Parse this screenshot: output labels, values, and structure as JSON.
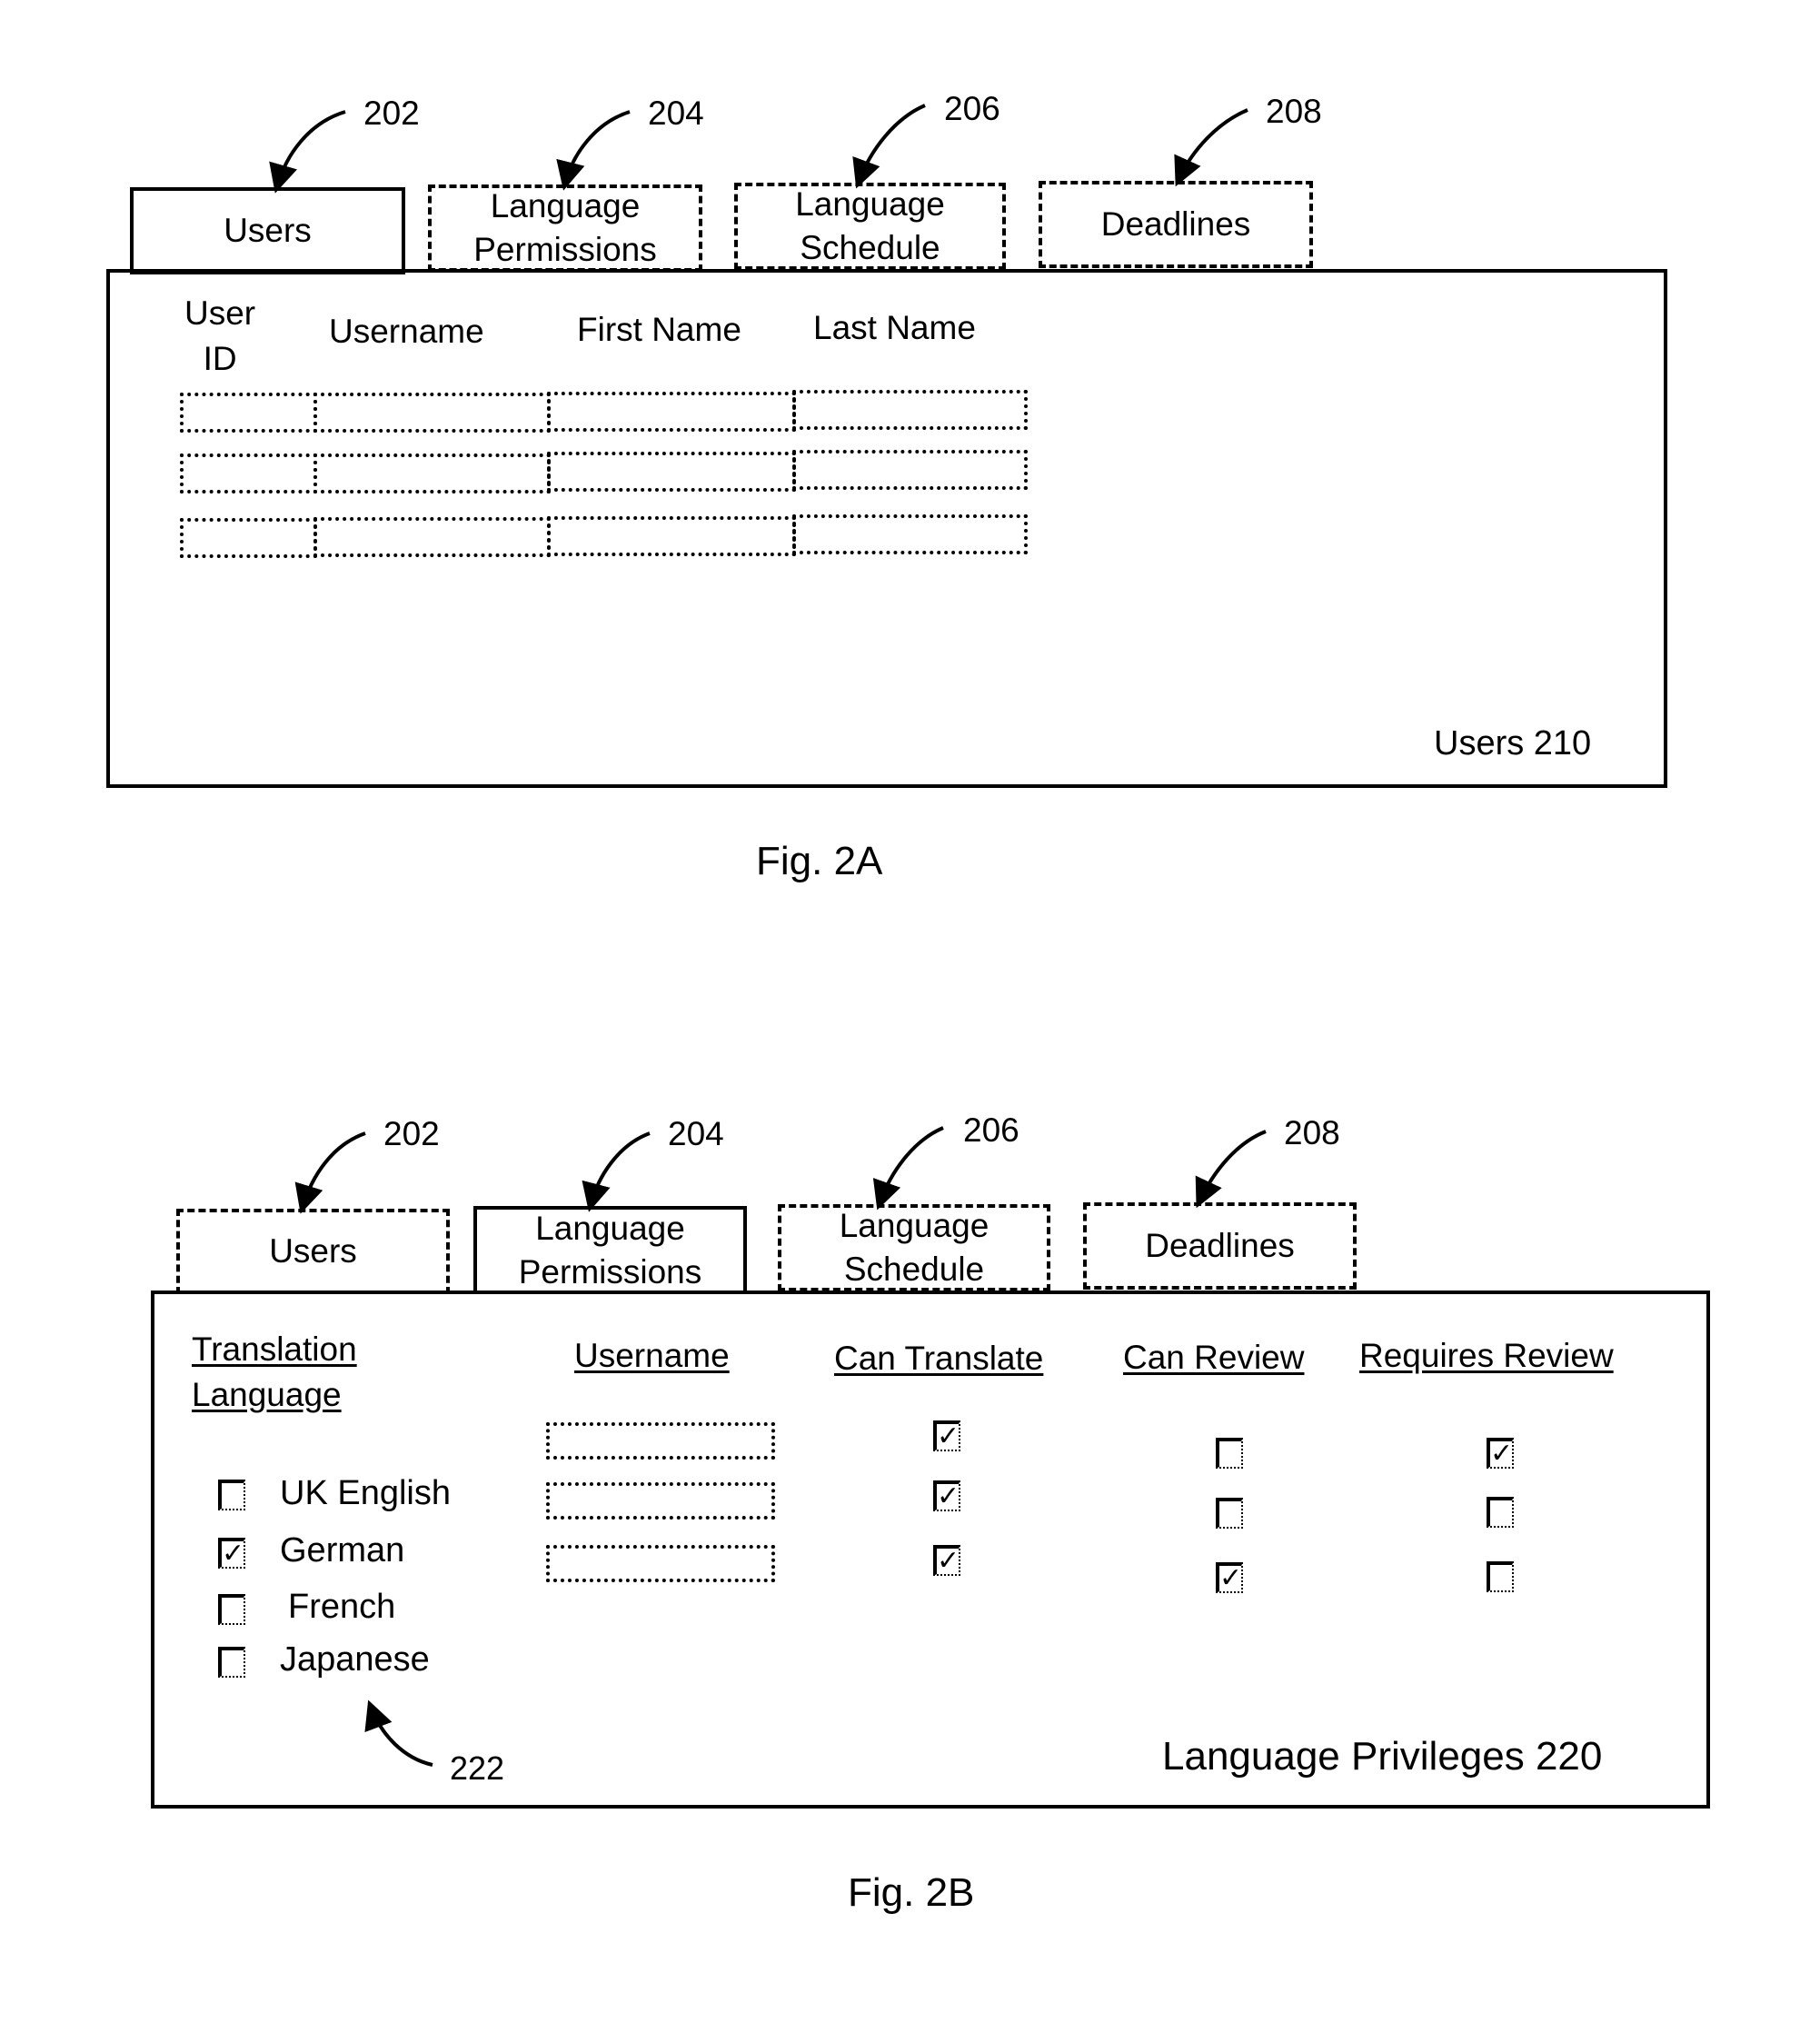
{
  "figures": [
    {
      "caption": "Fig. 2A",
      "tabs": [
        {
          "label": "Users",
          "ref": "202",
          "active": true
        },
        {
          "label": "Language\nPermissions",
          "ref": "204",
          "active": false
        },
        {
          "label": "Language\nSchedule",
          "ref": "206",
          "active": false
        },
        {
          "label": "Deadlines",
          "ref": "208",
          "active": false
        }
      ],
      "panel_label": "Users 210",
      "columns": [
        "User\nID",
        "Username",
        "First Name",
        "Last Name"
      ],
      "row_count": 3
    },
    {
      "caption": "Fig. 2B",
      "tabs": [
        {
          "label": "Users",
          "ref": "202",
          "active": false
        },
        {
          "label": "Language\nPermissions",
          "ref": "204",
          "active": true
        },
        {
          "label": "Language\nSchedule",
          "ref": "206",
          "active": false
        },
        {
          "label": "Deadlines",
          "ref": "208",
          "active": false
        }
      ],
      "panel_label": "Language Privileges 220",
      "language_header": "Translation\nLanguage",
      "languages": [
        {
          "label": "UK English",
          "checked": false
        },
        {
          "label": "German",
          "checked": true
        },
        {
          "label": "French",
          "checked": false
        },
        {
          "label": "Japanese",
          "checked": false
        }
      ],
      "language_list_ref": "222",
      "columns": [
        "Username",
        "Can Translate",
        "Can Review",
        "Requires Review"
      ],
      "rows": [
        {
          "username": "",
          "can_translate": true,
          "can_review": false,
          "requires_review": true
        },
        {
          "username": "",
          "can_translate": true,
          "can_review": false,
          "requires_review": false
        },
        {
          "username": "",
          "can_translate": true,
          "can_review": true,
          "requires_review": false
        }
      ]
    }
  ],
  "icons": {
    "check": "✓",
    "arrow": "curved-arrow-icon"
  }
}
